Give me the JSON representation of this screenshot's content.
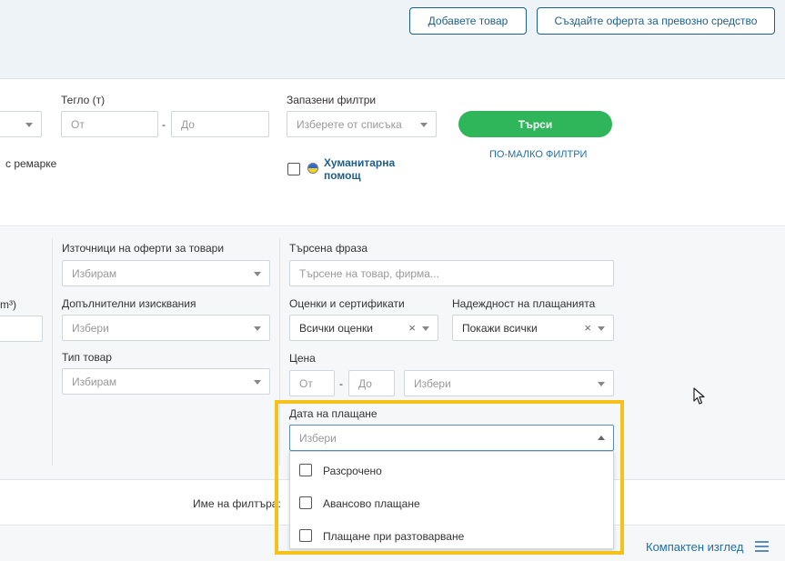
{
  "header": {
    "add_goods_label": "Добавете товар",
    "create_vehicle_offer_label": "Създайте оферта за превозно средство"
  },
  "filters_top": {
    "weight_label": "Тегло (т)",
    "weight_from_placeholder": "От",
    "weight_to_placeholder": "До",
    "weight_dash": "-",
    "saved_filters_label": "Запазени филтри",
    "saved_filters_placeholder": "Изберете от списъка",
    "search_button_label": "Търси",
    "fewer_filters_label": "ПО-МАЛКО ФИЛТРИ",
    "trailer_text": "с ремарке",
    "humanitarian_label_line1": "Хуманитарна",
    "humanitarian_label_line2": "помощ"
  },
  "filters_extended": {
    "cut_label": "m³)",
    "sources_label": "Източници на оферти за товари",
    "sources_placeholder": "Избирам",
    "additional_req_label": "Допълнителни изисквания",
    "additional_req_placeholder": "Избери",
    "goods_type_label": "Тип товар",
    "goods_type_placeholder": "Избирам",
    "search_phrase_label": "Търсена фраза",
    "search_phrase_placeholder": "Търсене на товар, фирма...",
    "ratings_label": "Оценки и сертификати",
    "ratings_value": "Всички оценки",
    "reliability_label": "Надеждност на плащанията",
    "reliability_value": "Покажи всички",
    "clear_symbol": "×",
    "price_label": "Цена",
    "price_from_placeholder": "От",
    "price_to_placeholder": "До",
    "price_dash": "-",
    "price_currency_placeholder": "Избери",
    "payment_date_label": "Дата на плащане",
    "payment_date_placeholder": "Избери",
    "payment_options": [
      {
        "label": "Разсрочено"
      },
      {
        "label": "Авансово плащане"
      },
      {
        "label": "Плащане при разтоварване"
      }
    ]
  },
  "filter_name": {
    "label": "Име на филтъра:"
  },
  "footer": {
    "compact_view_label": "Компактен изглед"
  },
  "colors": {
    "accent_blue": "#1d5f8a",
    "search_green": "#2fb55a",
    "highlight_yellow": "#f4c21a"
  }
}
